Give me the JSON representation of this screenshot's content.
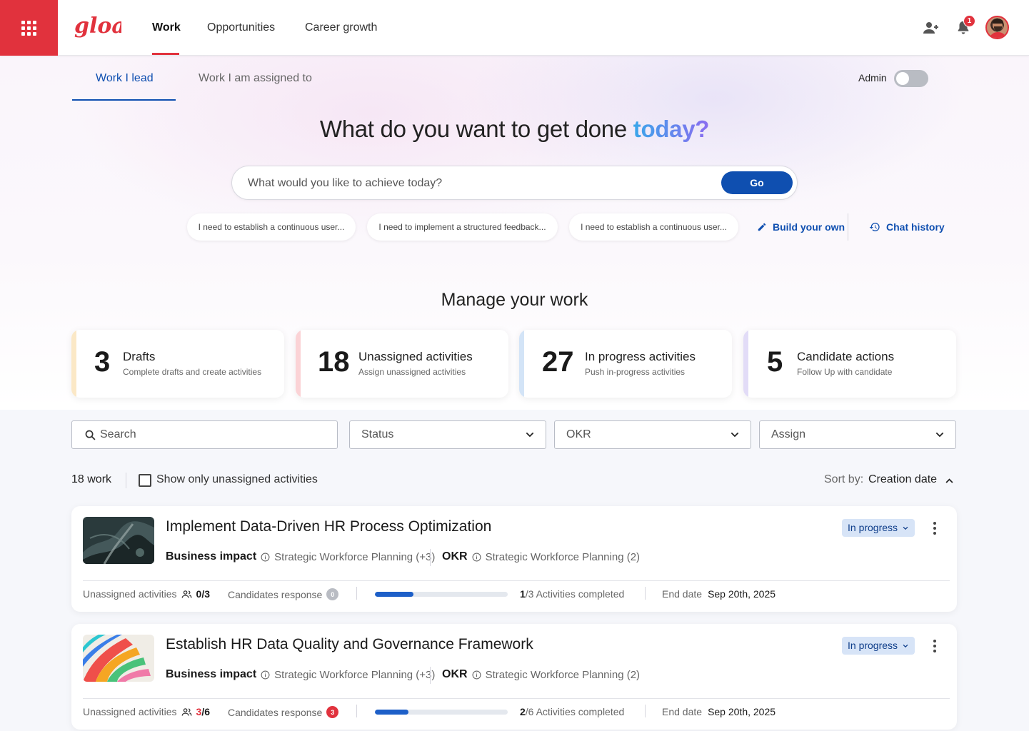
{
  "topnav": {
    "logo_text": "gloat",
    "items": [
      "Work",
      "Opportunities",
      "Career growth"
    ],
    "notification_count": "1"
  },
  "tabs": {
    "lead": "Work I lead",
    "assigned": "Work I am assigned to"
  },
  "admin": {
    "label": "Admin",
    "enabled": false
  },
  "hero": {
    "title_main": "What do you want to get done ",
    "title_accent": "today?",
    "search_placeholder": "What would you like to achieve today?",
    "go_label": "Go",
    "suggestions": [
      "I need to establish a continuous user...",
      "I need to implement a structured feedback...",
      "I need to establish a continuous user..."
    ],
    "build_own": "Build your own",
    "chat_history": "Chat history"
  },
  "manage": {
    "title": "Manage your work",
    "stats": [
      {
        "number": "3",
        "title": "Drafts",
        "subtitle": "Complete drafts and create activities",
        "accent": "#fbe8c6"
      },
      {
        "number": "18",
        "title": "Unassigned activities",
        "subtitle": "Assign unassigned activities",
        "accent": "#fbd3d6"
      },
      {
        "number": "27",
        "title": "In progress activities",
        "subtitle": "Push in-progress activities",
        "accent": "#d3e4f7"
      },
      {
        "number": "5",
        "title": "Candidate actions",
        "subtitle": "Follow Up with candidate",
        "accent": "#e2dcf7"
      }
    ]
  },
  "filters": {
    "search_placeholder": "Search",
    "status": "Status",
    "okr": "OKR",
    "assign": "Assign"
  },
  "list": {
    "count": "18 work",
    "only_unassigned": "Show only unassigned activities",
    "sort_label": "Sort by:",
    "sort_value": "Creation date"
  },
  "work_items": [
    {
      "title": "Implement Data-Driven HR Process Optimization",
      "status": "In progress",
      "business_impact_label": "Business impact",
      "business_impact_value": "Strategic Workforce Planning (+3)",
      "okr_label": "OKR",
      "okr_value": "Strategic Workforce Planning (2)",
      "unassigned_label": "Unassigned activities",
      "unassigned_num": "0",
      "unassigned_total": "/3",
      "candidates_label": "Candidates response",
      "candidates_count": "0",
      "candidates_color": "#b9bcc3",
      "activities_done": "1",
      "activities_text": "/3 Activities completed",
      "progress": 0.29,
      "end_label": "End date",
      "end_value": "Sep 20th, 2025"
    },
    {
      "title": "Establish HR Data Quality and Governance Framework",
      "status": "In progress",
      "business_impact_label": "Business impact",
      "business_impact_value": "Strategic Workforce Planning (+3)",
      "okr_label": "OKR",
      "okr_value": "Strategic Workforce Planning (2)",
      "unassigned_label": "Unassigned activities",
      "unassigned_num": "3",
      "unassigned_total": "/6",
      "candidates_label": "Candidates response",
      "candidates_count": "3",
      "candidates_color": "#e1323d",
      "activities_done": "2",
      "activities_text": "/6 Activities completed",
      "progress": 0.25,
      "end_label": "End date",
      "end_value": "Sep 20th, 2025"
    }
  ]
}
